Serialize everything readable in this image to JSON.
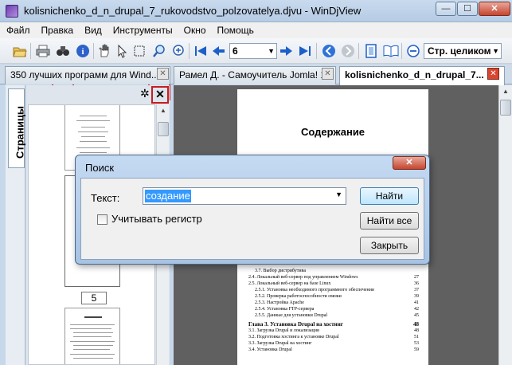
{
  "window": {
    "title": "kolisnichenko_d_n_drupal_7_rukovodstvo_polzovatelya.djvu - WinDjView",
    "minimize": "—",
    "maximize": "☐",
    "close": "✕"
  },
  "menu": [
    "Файл",
    "Правка",
    "Вид",
    "Инструменты",
    "Окно",
    "Помощь"
  ],
  "toolbar": {
    "page_value": "6",
    "zoom_value": "Стр. целиком",
    "icons": [
      "open-icon",
      "print-icon",
      "find-icon",
      "info-icon",
      "hand-icon",
      "select-icon",
      "rect-select-icon",
      "magnify-icon",
      "zoom-icon",
      "first-page-icon",
      "prev-page-icon",
      "next-page-icon",
      "last-page-icon",
      "back-icon",
      "forward-icon",
      "single-page-icon",
      "two-page-icon",
      "zoom-out-icon"
    ],
    "highlight_color": "#c81c22"
  },
  "tabs": [
    {
      "label": "350 лучших программ для Wind...",
      "active": false
    },
    {
      "label": "Рамел Д. - Самоучитель Jomla! 1...",
      "active": false
    },
    {
      "label": "kolisnichenko_d_n_drupal_7...",
      "active": true
    }
  ],
  "side_panel": {
    "tab_label": "Страницы",
    "page_number": "5"
  },
  "document": {
    "heading": "Содержание",
    "toc": [
      {
        "text": "3.7. Выбор дистрибутива",
        "page": "",
        "kind": "sub"
      },
      {
        "text": "2.4. Локальный веб-сервер под управлением Windows",
        "page": "27",
        "kind": "item"
      },
      {
        "text": "2.5. Локальный веб-сервер на базе Linux",
        "page": "36",
        "kind": "item"
      },
      {
        "text": "2.5.1. Установка необходимого программного обеспечения",
        "page": "37",
        "kind": "sub"
      },
      {
        "text": "2.5.2. Проверка работоспособности связки",
        "page": "39",
        "kind": "sub"
      },
      {
        "text": "2.5.3. Настройка Apache",
        "page": "41",
        "kind": "sub"
      },
      {
        "text": "2.5.4. Установка FTP-сервера",
        "page": "42",
        "kind": "sub"
      },
      {
        "text": "2.5.5. Данные для установки Drupal",
        "page": "45",
        "kind": "sub"
      },
      {
        "text": "Глава 3. Установка Drupal на хостинг",
        "page": "48",
        "kind": "chapter"
      },
      {
        "text": "3.1. Загрузка Drupal и локализация",
        "page": "48",
        "kind": "item"
      },
      {
        "text": "3.2. Подготовка хостинга к установке Drupal",
        "page": "51",
        "kind": "item"
      },
      {
        "text": "3.3. Загрузка Drupal на хостинг",
        "page": "53",
        "kind": "item"
      },
      {
        "text": "3.4. Установка Drupal",
        "page": "59",
        "kind": "item"
      }
    ]
  },
  "dialog": {
    "title": "Поиск",
    "close": "✕",
    "text_label": "Текст:",
    "search_value": "создание",
    "case_label": "Учитывать регистр",
    "find_button": "Найти",
    "find_all_button": "Найти все",
    "close_button": "Закрыть"
  }
}
